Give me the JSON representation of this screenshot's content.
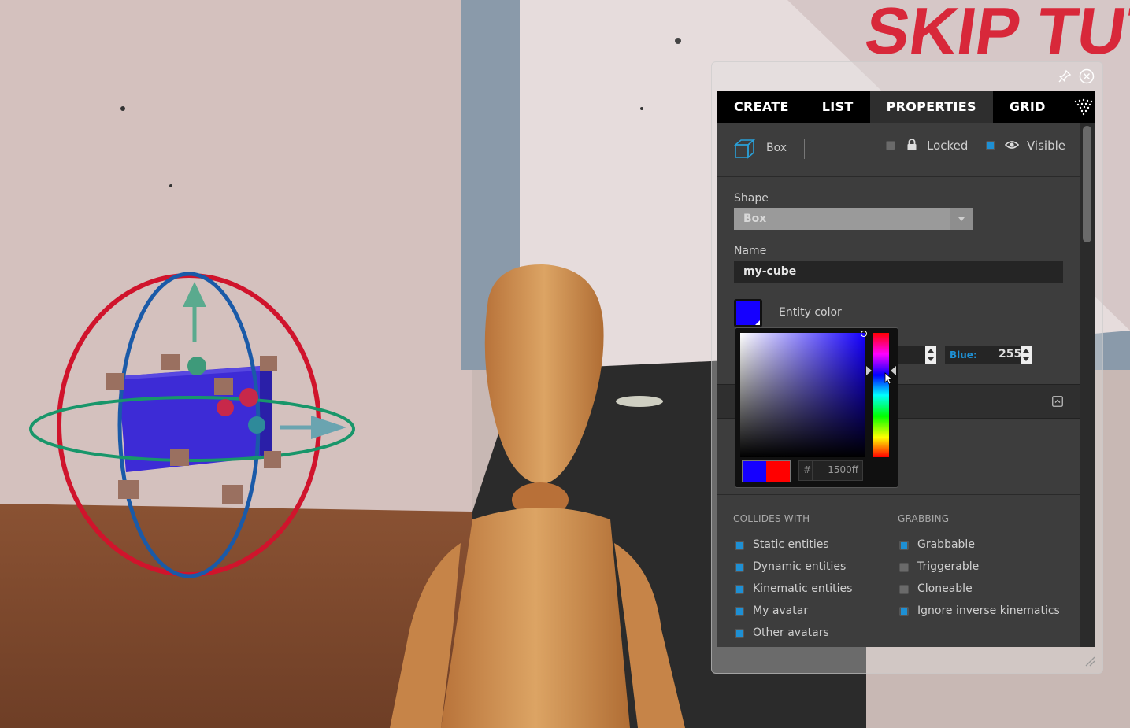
{
  "scene": {
    "wall_sign_text": "SKIP TUTORIAL"
  },
  "panel": {
    "pin_icon": "pin-icon",
    "close_icon": "close-circle-icon"
  },
  "tabs": [
    {
      "label": "CREATE"
    },
    {
      "label": "LIST"
    },
    {
      "label": "PROPERTIES",
      "active": true
    },
    {
      "label": "GRID"
    }
  ],
  "header": {
    "entity_type": "Box",
    "locked_label": "Locked",
    "locked_checked": false,
    "visible_label": "Visible",
    "visible_checked": true
  },
  "shape": {
    "label": "Shape",
    "value": "Box"
  },
  "name": {
    "label": "Name",
    "value": "my-cube"
  },
  "color": {
    "label": "Entity color",
    "swatch": "#1500ff",
    "blue_label": "Blue:",
    "blue_value": "255",
    "accent": "#1e90d4"
  },
  "picker": {
    "hash": "#",
    "hex_value": "1500ff",
    "new_color": "#1500ff",
    "old_color": "#ff0000"
  },
  "collides": {
    "caption": "COLLIDES WITH",
    "items": [
      {
        "label": "Static entities",
        "checked": true
      },
      {
        "label": "Dynamic entities",
        "checked": true
      },
      {
        "label": "Kinematic entities",
        "checked": true
      },
      {
        "label": "My avatar",
        "checked": true
      },
      {
        "label": "Other avatars",
        "checked": true
      }
    ]
  },
  "grabbing": {
    "caption": "GRABBING",
    "items": [
      {
        "label": "Grabbable",
        "checked": true
      },
      {
        "label": "Triggerable",
        "checked": false
      },
      {
        "label": "Cloneable",
        "checked": false
      },
      {
        "label": "Ignore inverse kinematics",
        "checked": true
      }
    ]
  }
}
